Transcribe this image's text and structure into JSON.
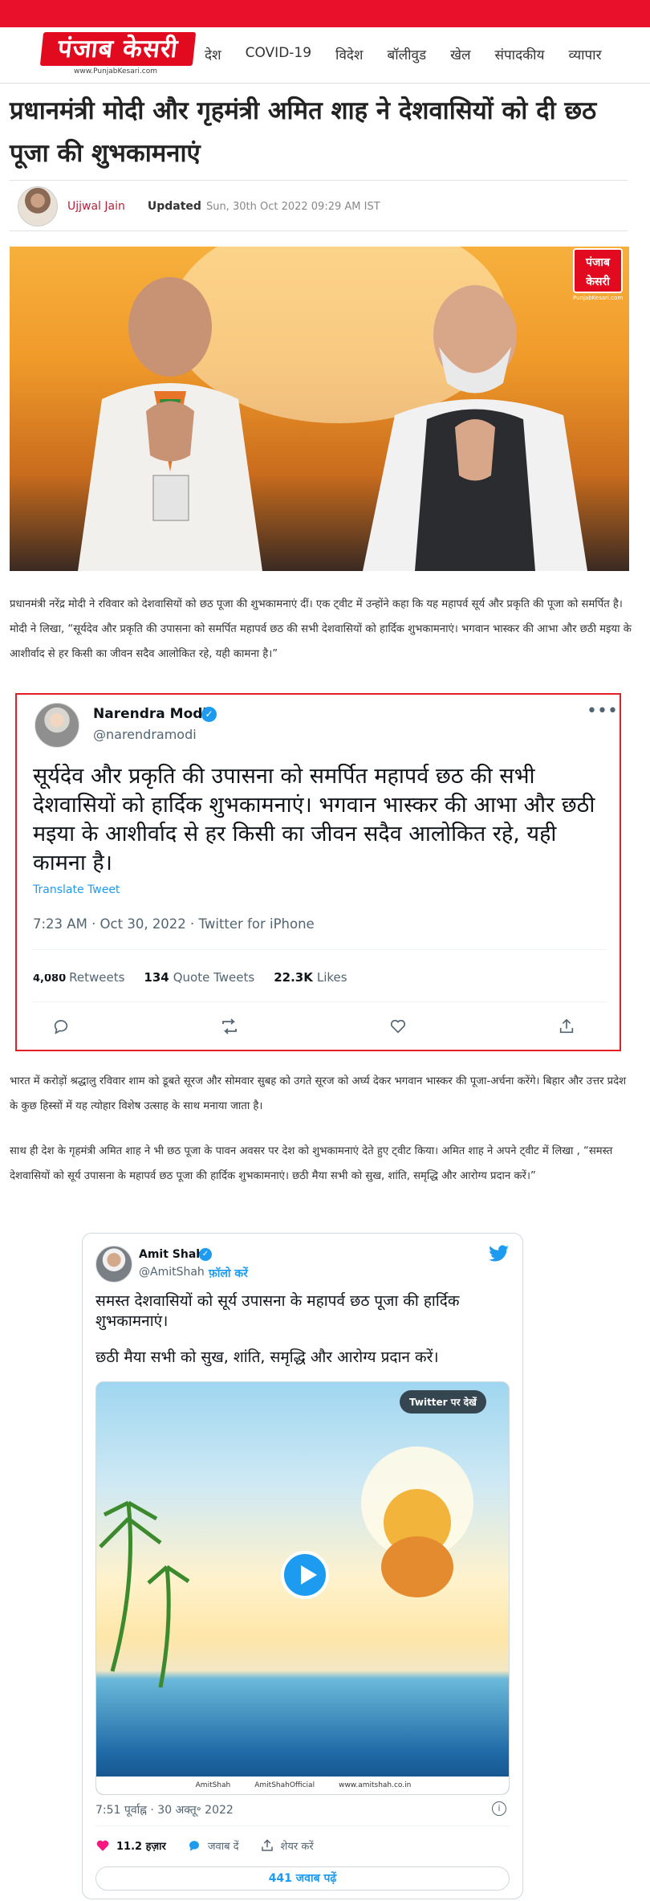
{
  "site": {
    "logo_text": "पंजाब केसरी",
    "logo_url": "www.PunjabKesari.com",
    "accent_color": "#e10a1e"
  },
  "nav": [
    "देश",
    "COVID-19",
    "विदेश",
    "बॉलीवुड",
    "खेल",
    "संपादकीय",
    "व्यापार"
  ],
  "article": {
    "title": "प्रधानमंत्री मोदी और गृहमंत्री अमित शाह ने देशवासियों को दी छठ पूजा की शुभकामनाएं",
    "author": "Ujjwal Jain",
    "updated_label": "Updated",
    "updated_date": "Sun, 30th Oct 2022 09:29 AM IST",
    "image_badge": "पंजाब केसरी",
    "image_badge_url": "PunjabKesari.com",
    "para1": "प्रधानमंत्री नरेंद्र मोदी ने रविवार को देशवासियों को छठ पूजा की शुभकामनाएं दीं। एक ट्वीट में उन्होंने कहा कि यह महापर्व सूर्य और प्रकृति की पूजा को समर्पित है।मोदी ने लिखा, “सूर्यदेव और प्रकृति की उपासना को समर्पित महापर्व छठ की सभी देशवासियों को हार्दिक शुभकामनाएं। भगवान भास्कर की आभा और छठी मइया के आशीर्वाद से हर किसी का जीवन सदैव आलोकित रहे, यही कामना है।”",
    "para2": "भारत में करोड़ों श्रद्धालु रविवार शाम को डूबते सूरज और सोमवार सुबह को उगते सूरज को अर्घ्य देकर भगवान भास्कर की पूजा-अर्चना करेंगे। बिहार और उत्तर प्रदेश के कुछ हिस्सों में यह त्योहार विशेष उत्साह के साथ मनाया जाता है।",
    "para3": "साथ ही देश के गृहमंत्री अमित शाह ने भी छठ पूजा के पावन अवसर पर देश को शुभकामनाएं देते हुए ट्वीट किया।  अमित शाह ने अपने ट्वीट में लिखा , “समस्त देशवासियों को सूर्य उपासना के महापर्व छठ पूजा की हार्दिक शुभकामनाएं। छठी मैया सभी को सुख, शांति, समृद्धि और आरोग्य प्रदान करें।”"
  },
  "tweet1": {
    "name": "Narendra Modi",
    "handle": "@narendramodi",
    "text": "सूर्यदेव और प्रकृति की उपासना को समर्पित महापर्व छठ की सभी देशवासियों को हार्दिक शुभकामनाएं। भगवान भास्कर की आभा और छठी मइया के आशीर्वाद से हर किसी का जीवन सदैव आलोकित रहे, यही कामना है।",
    "translate": "Translate Tweet",
    "meta": "7:23 AM · Oct 30, 2022 · Twitter for iPhone",
    "retweets_count": "4,080",
    "retweets_label": "Retweets",
    "quotes_count": "134",
    "quotes_label": "Quote Tweets",
    "likes_count": "22.3K",
    "likes_label": "Likes",
    "border_color": "#e21f26"
  },
  "tweet2": {
    "name": "Amit Shah",
    "handle": "@AmitShah",
    "follow": "फ़ॉलो करें",
    "text1": "समस्त देशवासियों को सूर्य उपासना के महापर्व छठ पूजा की हार्दिक शुभकामनाएं।",
    "text2": "छठी मैया सभी को सुख, शांति, समृद्धि और आरोग्य प्रदान करें।",
    "watch_label": "Twitter पर देखें",
    "footer": [
      "AmitShah",
      "AmitShahOfficial",
      "www.amitshah.co.in"
    ],
    "time": "7:51 पूर्वाह्न · 30 अक्तू॰ 2022",
    "info_icon": "i",
    "likes": "11.2 हज़ार",
    "reply_label": "जवाब दें",
    "share_label": "शेयर करें",
    "replies_button": "441 जवाब पढ़ें"
  }
}
